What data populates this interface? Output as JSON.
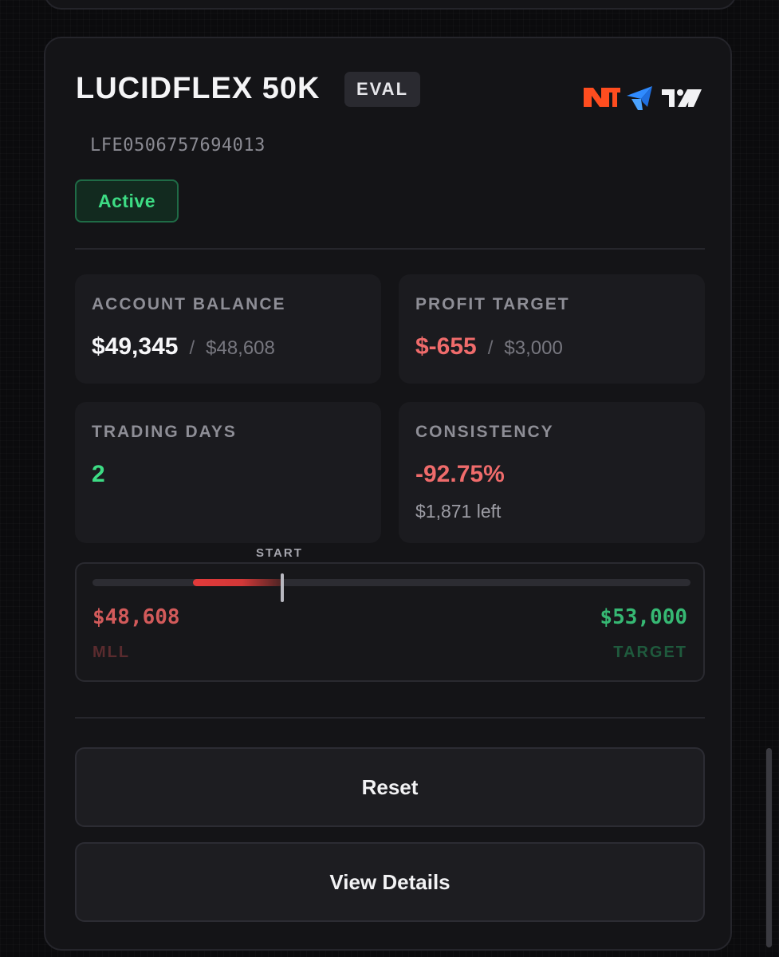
{
  "account": {
    "title": "LUCIDFLEX 50K",
    "type_badge": "EVAL",
    "id": "LFE0506757694013",
    "status": "Active",
    "platform_icons": [
      "ninjatrader-icon",
      "tradovate-icon",
      "tradingview-icon"
    ]
  },
  "stats": {
    "balance": {
      "label": "ACCOUNT BALANCE",
      "value": "$49,345",
      "separator": "/",
      "sub": "$48,608"
    },
    "profit_target": {
      "label": "PROFIT TARGET",
      "value": "$-655",
      "separator": "/",
      "sub": "$3,000"
    },
    "trading_days": {
      "label": "TRADING DAYS",
      "value": "2"
    },
    "consistency": {
      "label": "CONSISTENCY",
      "value": "-92.75%",
      "note": "$1,871 left"
    }
  },
  "progress": {
    "start_label": "START",
    "min_value": 48608,
    "start_value": 50000,
    "current_value": 49345,
    "max_value": 53000,
    "mll_value": "$48,608",
    "mll_label": "MLL",
    "target_value": "$53,000",
    "target_label": "TARGET"
  },
  "actions": {
    "reset_label": "Reset",
    "details_label": "View Details"
  },
  "colors": {
    "accent_green": "#3ddc84",
    "accent_red": "#ef6b6b",
    "background": "#0b0b0d",
    "card": "#141417"
  }
}
